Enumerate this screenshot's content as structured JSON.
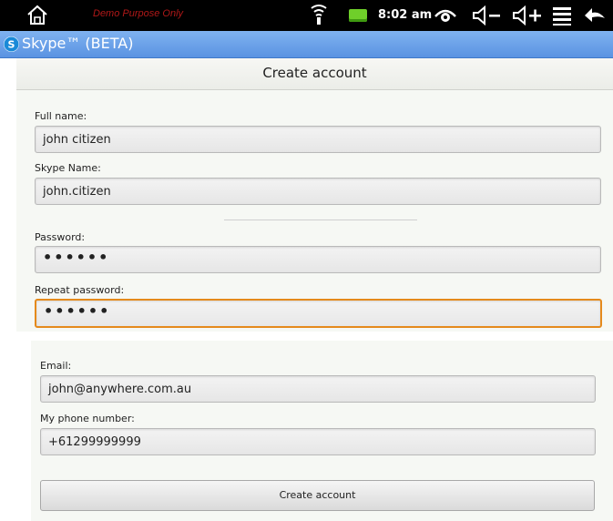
{
  "status_bar": {
    "demo_label": "Demo Purpose Only",
    "time": "8:02 am",
    "icons": [
      "home-icon",
      "wifi-icon",
      "battery-icon",
      "eye-icon",
      "volume-down-icon",
      "volume-up-icon",
      "menu-icon",
      "back-icon"
    ]
  },
  "app": {
    "title": "Skype™ (BETA)",
    "accent_color": "#5a93e2"
  },
  "page": {
    "title": "Create account"
  },
  "form": {
    "full_name": {
      "label": "Full name:",
      "value": "john citizen"
    },
    "skype_name": {
      "label": "Skype Name:",
      "value": "john.citizen"
    },
    "password": {
      "label": "Password:",
      "value": "••••••"
    },
    "repeat_password": {
      "label": "Repeat password:",
      "value": "••••••"
    },
    "email": {
      "label": "Email:",
      "value": "john@anywhere.com.au"
    },
    "phone": {
      "label": "My phone number:",
      "value": "+61299999999"
    },
    "submit_label": "Create account"
  }
}
